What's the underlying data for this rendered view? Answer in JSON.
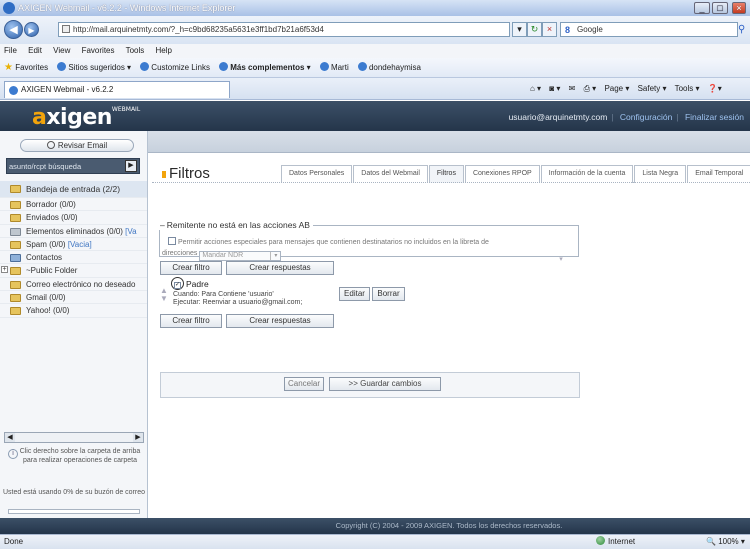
{
  "window": {
    "title": "AXIGEN Webmail - v6.2.2 - Windows Internet Explorer",
    "url": "http://mail.arquinetmty.com/?_h=c9bd68235a5631e3ff1bd7b21a6f53d4",
    "search_engine": "Google"
  },
  "menu": [
    "File",
    "Edit",
    "View",
    "Favorites",
    "Tools",
    "Help"
  ],
  "favorites_bar": {
    "label": "Favorites",
    "items": [
      "Sitios sugeridos ▾",
      "Customize Links",
      "Más complementos ▾",
      "Marti",
      "dondehaymisa"
    ]
  },
  "tab": {
    "label": "AXIGEN Webmail - v6.2.2"
  },
  "command_bar": [
    "Page ▾",
    "Safety ▾",
    "Tools ▾"
  ],
  "header": {
    "logo": "axigen",
    "logo_super": "WEBMAIL",
    "user": "usuario@arquinetmty.com",
    "config_link": "Configuración",
    "logout_link": "Finalizar sesión"
  },
  "sidebar": {
    "check_email": "Revisar Email",
    "search_value": "asunto/rcpt búsqueda",
    "folders": [
      {
        "label": "Bandeja de entrada (2/2)",
        "vaciar": ""
      },
      {
        "label": "Borrador (0/0)",
        "vaciar": ""
      },
      {
        "label": "Enviados (0/0)",
        "vaciar": ""
      },
      {
        "label": "Elementos eliminados (0/0)",
        "vaciar": "[Va"
      },
      {
        "label": "Spam (0/0)",
        "vaciar": "[Vacia]"
      },
      {
        "label": "Contactos",
        "vaciar": ""
      },
      {
        "label": "~Public Folder",
        "vaciar": ""
      },
      {
        "label": "Correo electrónico no deseado",
        "vaciar": ""
      },
      {
        "label": "Gmail (0/0)",
        "vaciar": ""
      },
      {
        "label": "Yahoo! (0/0)",
        "vaciar": ""
      }
    ],
    "hint": "Clic derecho sobre la carpeta de arriba para realizar operaciones de carpeta",
    "usage": "Usted está usando 0% de su buzón de correo",
    "usage_percent": 0
  },
  "main": {
    "title": "Filtros",
    "tabs": [
      "Datos Personales",
      "Datos del Webmail",
      "Filtros",
      "Conexiones RPOP",
      "Información de la cuenta",
      "Lista Negra",
      "Email Temporal"
    ],
    "active_tab": 2,
    "section_title": "Remitente no está en las acciones AB",
    "section_toggle": "–",
    "permit_text": "Permitir acciones especiales para mensajes que contienen destinatarios no incluidos en la libreta de",
    "direcciones_label": "direcciones",
    "ndr_value": "Mandar NDR",
    "crear_filtro": "Crear filtro",
    "crear_respuestas": "Crear respuestas",
    "filter_name": "Padre",
    "filter_condition": "Cuando:  Para  Contiene 'usuario'",
    "filter_action": "Ejecutar:  Reenviar a usuario@gmail.com;",
    "editar": "Editar",
    "borrar": "Borrar",
    "cancelar": "Cancelar",
    "guardar": ">> Guardar cambios"
  },
  "footer": {
    "copyright": "Copyright (C) 2004 - 2009 AXIGEN. Todos los derechos reservados."
  },
  "status": {
    "left": "Done",
    "zone": "Internet",
    "zoom": "100%"
  }
}
